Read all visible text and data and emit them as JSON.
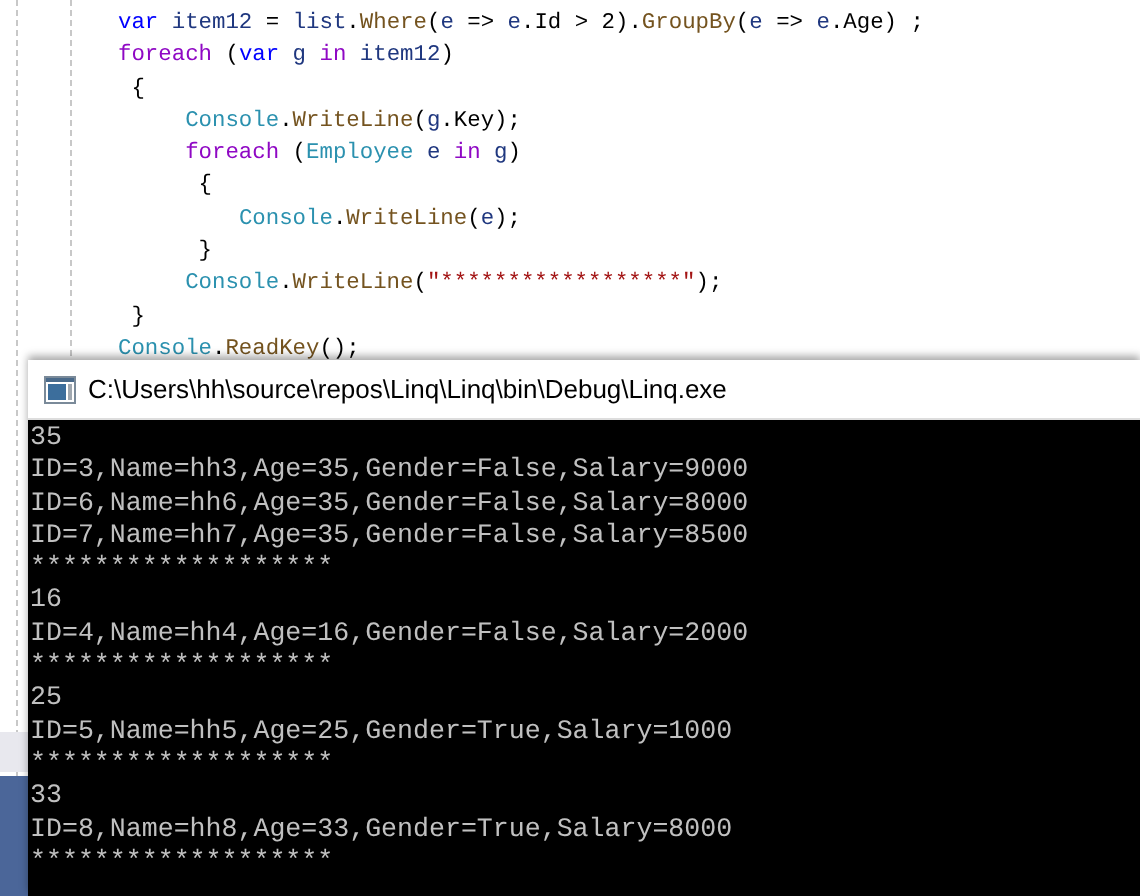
{
  "editor": {
    "lines": [
      [
        {
          "kind": "keyword",
          "text": "var "
        },
        {
          "kind": "local",
          "text": "item12"
        },
        {
          "kind": "plain",
          "text": " = "
        },
        {
          "kind": "local",
          "text": "list"
        },
        {
          "kind": "plain",
          "text": "."
        },
        {
          "kind": "method",
          "text": "Where"
        },
        {
          "kind": "plain",
          "text": "("
        },
        {
          "kind": "local",
          "text": "e"
        },
        {
          "kind": "plain",
          "text": " => "
        },
        {
          "kind": "local",
          "text": "e"
        },
        {
          "kind": "plain",
          "text": ".Id > 2)."
        },
        {
          "kind": "method",
          "text": "GroupBy"
        },
        {
          "kind": "plain",
          "text": "("
        },
        {
          "kind": "local",
          "text": "e"
        },
        {
          "kind": "plain",
          "text": " => "
        },
        {
          "kind": "local",
          "text": "e"
        },
        {
          "kind": "plain",
          "text": ".Age) ;"
        }
      ],
      [
        {
          "kind": "control",
          "text": "foreach"
        },
        {
          "kind": "plain",
          "text": " ("
        },
        {
          "kind": "keyword",
          "text": "var "
        },
        {
          "kind": "local",
          "text": "g "
        },
        {
          "kind": "control",
          "text": "in "
        },
        {
          "kind": "local",
          "text": "item12"
        },
        {
          "kind": "plain",
          "text": ")"
        }
      ],
      [
        {
          "kind": "plain",
          "text": " {"
        }
      ],
      [
        {
          "kind": "type",
          "text": "     Console"
        },
        {
          "kind": "plain",
          "text": "."
        },
        {
          "kind": "method",
          "text": "WriteLine"
        },
        {
          "kind": "plain",
          "text": "("
        },
        {
          "kind": "local",
          "text": "g"
        },
        {
          "kind": "plain",
          "text": ".Key);"
        }
      ],
      [
        {
          "kind": "control",
          "text": "     foreach"
        },
        {
          "kind": "plain",
          "text": " ("
        },
        {
          "kind": "type",
          "text": "Employee "
        },
        {
          "kind": "local",
          "text": "e "
        },
        {
          "kind": "control",
          "text": "in "
        },
        {
          "kind": "local",
          "text": "g"
        },
        {
          "kind": "plain",
          "text": ")"
        }
      ],
      [
        {
          "kind": "plain",
          "text": "      {"
        }
      ],
      [
        {
          "kind": "type",
          "text": "         Console"
        },
        {
          "kind": "plain",
          "text": "."
        },
        {
          "kind": "method",
          "text": "WriteLine"
        },
        {
          "kind": "plain",
          "text": "("
        },
        {
          "kind": "local",
          "text": "e"
        },
        {
          "kind": "plain",
          "text": ");"
        }
      ],
      [
        {
          "kind": "plain",
          "text": "      }"
        }
      ],
      [
        {
          "kind": "type",
          "text": "     Console"
        },
        {
          "kind": "plain",
          "text": "."
        },
        {
          "kind": "method",
          "text": "WriteLine"
        },
        {
          "kind": "plain",
          "text": "("
        },
        {
          "kind": "string",
          "text": "\"******************\""
        },
        {
          "kind": "plain",
          "text": ");"
        }
      ],
      [
        {
          "kind": "plain",
          "text": " }"
        }
      ],
      [
        {
          "kind": "type",
          "text": "Console"
        },
        {
          "kind": "plain",
          "text": "."
        },
        {
          "kind": "method",
          "text": "ReadKey"
        },
        {
          "kind": "plain",
          "text": "();"
        }
      ]
    ]
  },
  "console_window": {
    "title": "C:\\Users\\hh\\source\\repos\\Linq\\Linq\\bin\\Debug\\Linq.exe",
    "output": [
      "35",
      "ID=3,Name=hh3,Age=35,Gender=False,Salary=9000",
      "ID=6,Name=hh6,Age=35,Gender=False,Salary=8000",
      "ID=7,Name=hh7,Age=35,Gender=False,Salary=8500",
      "*******************",
      "16",
      "ID=4,Name=hh4,Age=16,Gender=False,Salary=2000",
      "*******************",
      "25",
      "ID=5,Name=hh5,Age=25,Gender=True,Salary=1000",
      "*******************",
      "33",
      "ID=8,Name=hh8,Age=33,Gender=True,Salary=8000",
      "*******************"
    ]
  }
}
